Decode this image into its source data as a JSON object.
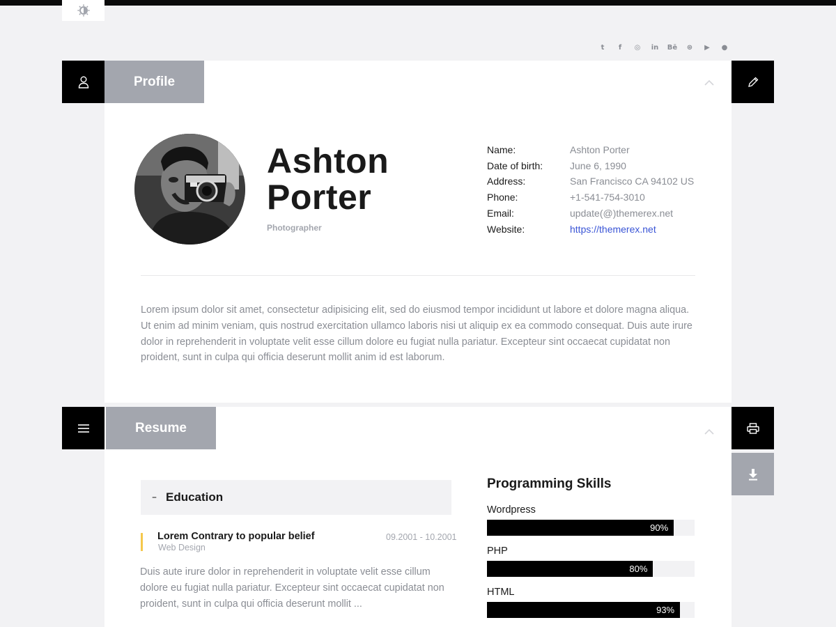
{
  "header": {
    "theme_toggle_icon": "contrast-icon",
    "socials": [
      {
        "name": "twitter",
        "glyph": "t"
      },
      {
        "name": "facebook",
        "glyph": "f"
      },
      {
        "name": "instagram",
        "glyph": "◎"
      },
      {
        "name": "linkedin",
        "glyph": "in"
      },
      {
        "name": "behance",
        "glyph": "Bē"
      },
      {
        "name": "dribbble",
        "glyph": "⊛"
      },
      {
        "name": "youtube",
        "glyph": "▶"
      },
      {
        "name": "other",
        "glyph": "●"
      }
    ]
  },
  "profile": {
    "tab_label": "Profile",
    "first_name": "Ashton",
    "last_name": "Porter",
    "role": "Photographer",
    "info": [
      {
        "key": "Name:",
        "value": "Ashton Porter"
      },
      {
        "key": "Date of birth:",
        "value": "June 6, 1990"
      },
      {
        "key": "Address:",
        "value": "San Francisco CA 94102 US"
      },
      {
        "key": "Phone:",
        "value": "+1-541-754-3010"
      },
      {
        "key": "Email:",
        "value": "update(@)themerex.net"
      },
      {
        "key": "Website:",
        "value": "https://themerex.net"
      }
    ],
    "bio": "Lorem ipsum dolor sit amet, consectetur adipisicing elit, sed do eiusmod tempor incididunt ut labore et dolore magna aliqua. Ut enim ad minim veniam, quis nostrud exercitation ullamco laboris nisi ut aliquip ex ea commodo consequat. Duis aute irure dolor in reprehenderit in voluptate velit esse cillum dolore eu fugiat nulla pariatur. Excepteur sint occaecat cupidatat non proident, sunt in culpa qui officia deserunt mollit anim id est laborum."
  },
  "resume": {
    "tab_label": "Resume",
    "education_label": "Education",
    "entry": {
      "title": "Lorem Contrary to popular belief",
      "subtitle": "Web Design",
      "date": "09.2001 - 10.2001",
      "text": "Duis aute irure dolor in reprehenderit in voluptate velit esse cillum dolore eu fugiat nulla pariatur. Excepteur sint occaecat cupidatat non proident, sunt in culpa qui officia deserunt mollit ..."
    },
    "skills_title": "Programming Skills",
    "skills": [
      {
        "name": "Wordpress",
        "percent": 90,
        "label": "90%"
      },
      {
        "name": "PHP",
        "percent": 80,
        "label": "80%"
      },
      {
        "name": "HTML",
        "percent": 93,
        "label": "93%"
      }
    ]
  },
  "colors": {
    "accent_link": "#3a55d6",
    "tab_gray": "#a3a6ae",
    "entry_marker": "#f5c84c"
  }
}
